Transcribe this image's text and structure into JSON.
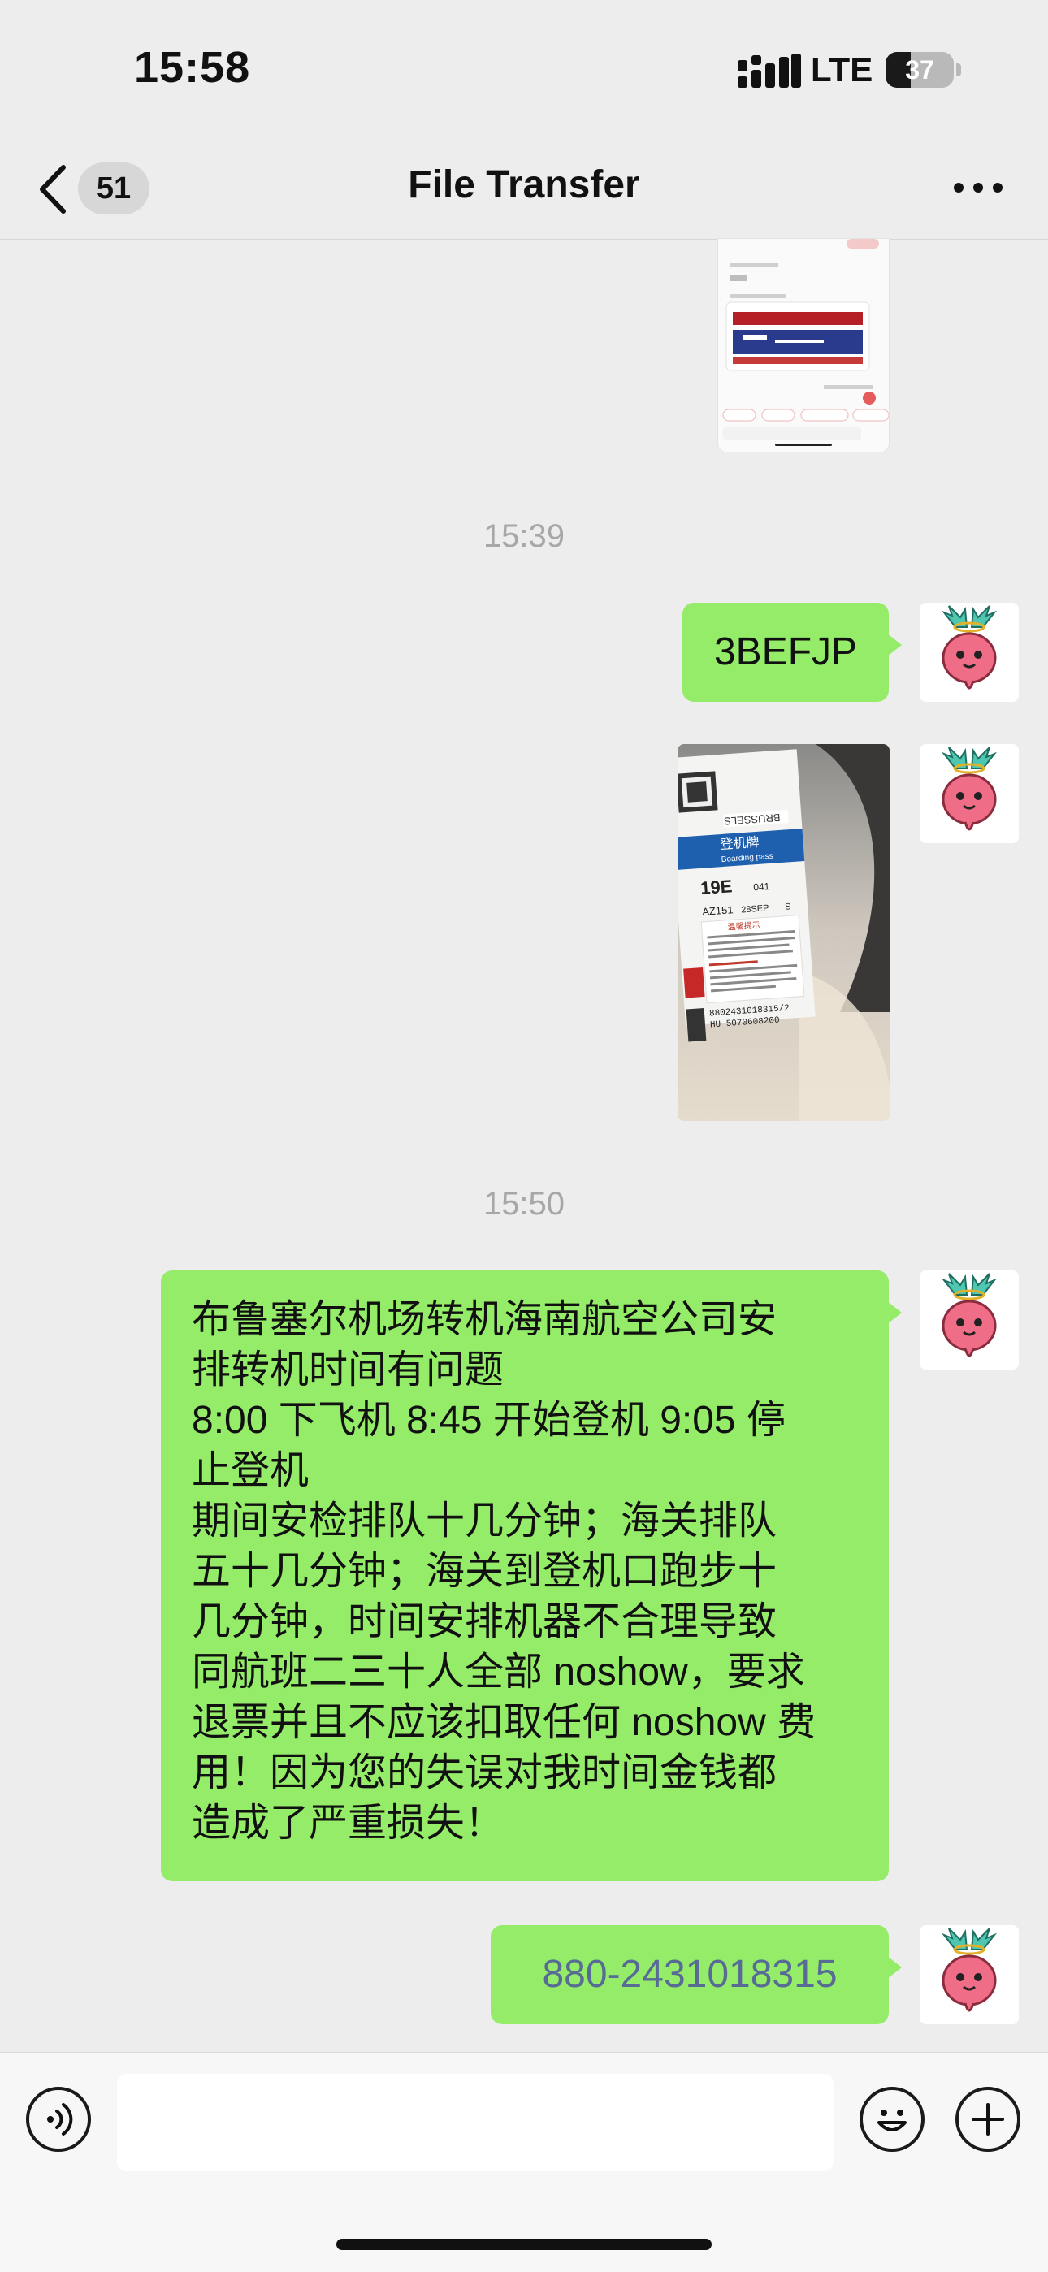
{
  "status_bar": {
    "time": "15:58",
    "network": "LTE",
    "battery_level": "37",
    "battery_fraction": 0.37
  },
  "nav": {
    "badge_count": "51",
    "title": "File Transfer",
    "back_icon": "chevron-left-icon",
    "more_icon": "more-dots-icon"
  },
  "messages": {
    "timestamp_1": "15:39",
    "code_text": "3BEFJP",
    "boarding_pass": {
      "city": "BRUSSELS",
      "header_cn": "登机牌",
      "header_en": "Boarding pass",
      "seat": "19E",
      "seq": "041",
      "flight": "AZ151",
      "date": "28SEP",
      "class": "S",
      "notice_title": "温馨提示",
      "ticket_no": "8802431018315/2",
      "hu_code": "HU 5070608200"
    },
    "timestamp_2": "15:50",
    "complaint_text": "布鲁塞尔机场转机海南航空公司安\n排转机时间有问题\n8:00 下飞机 8:45 开始登机 9:05 停\n止登机\n期间安检排队十几分钟；海关排队\n五十几分钟；海关到登机口跑步十\n几分钟，时间安排机器不合理导致\n同航班二三十人全部 noshow，要求\n退票并且不应该扣取任何 noshow 费\n用！因为您的失误对我时间金钱都\n造成了严重损失！",
    "ticket_number": "880-2431018315"
  },
  "input_bar": {
    "voice_icon": "voice-icon",
    "emoji_icon": "emoji-icon",
    "plus_icon": "plus-icon",
    "placeholder": ""
  },
  "colors": {
    "background": "#ededed",
    "bubble": "#95ec69",
    "link_number": "#576b95",
    "timestamp": "#a7a7a7"
  }
}
